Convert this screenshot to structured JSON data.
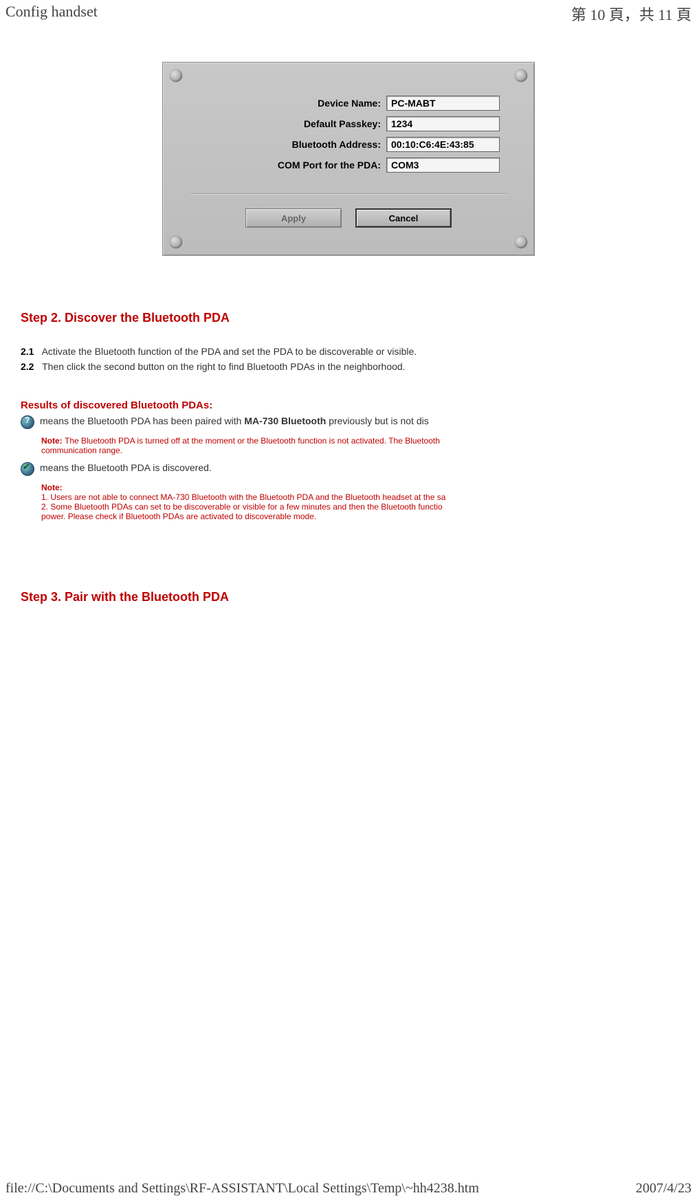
{
  "header": {
    "title": "Config handset",
    "pager": "第 10 頁，共 11 頁"
  },
  "dialog": {
    "fields": {
      "device_name": {
        "label": "Device Name:",
        "value": "PC-MABT"
      },
      "default_passkey": {
        "label": "Default Passkey:",
        "value": "1234"
      },
      "bt_address": {
        "label": "Bluetooth Address:",
        "value": "00:10:C6:4E:43:85"
      },
      "com_port": {
        "label": "COM Port for the PDA:",
        "value": "COM3"
      }
    },
    "buttons": {
      "apply": "Apply",
      "cancel": "Cancel"
    }
  },
  "step2": {
    "heading": "Step 2. Discover the Bluetooth PDA",
    "items": [
      {
        "num": "2.1",
        "text": "Activate the Bluetooth function of the PDA and set the PDA to be discoverable or visible."
      },
      {
        "num": "2.2",
        "text": "Then click the second button on the right to find Bluetooth PDAs in the neighborhood."
      }
    ]
  },
  "results": {
    "heading": "Results of discovered Bluetooth PDAs:",
    "line1_pre": "means the Bluetooth PDA has been paired with ",
    "line1_bold": "MA-730 Bluetooth",
    "line1_post": " previously but is not dis",
    "note1_label": "Note: ",
    "note1_text": "The Bluetooth PDA is turned off at the moment or the Bluetooth function is not activated. The Bluetooth",
    "note1_text2": "communication range.",
    "line2": "means the Bluetooth PDA is discovered.",
    "note2_label": "Note:",
    "note2_l1": "1. Users are not able to connect MA-730 Bluetooth with the Bluetooth PDA and the Bluetooth headset at the sa",
    "note2_l2": "2. Some Bluetooth PDAs can set to be discoverable or visible for a few minutes and then the Bluetooth functio",
    "note2_l3": "power. Please check if Bluetooth PDAs are activated to discoverable mode."
  },
  "step3": {
    "heading": "Step 3. Pair with the Bluetooth PDA"
  },
  "footer": {
    "path": "file://C:\\Documents and Settings\\RF-ASSISTANT\\Local Settings\\Temp\\~hh4238.htm",
    "date": "2007/4/23"
  }
}
